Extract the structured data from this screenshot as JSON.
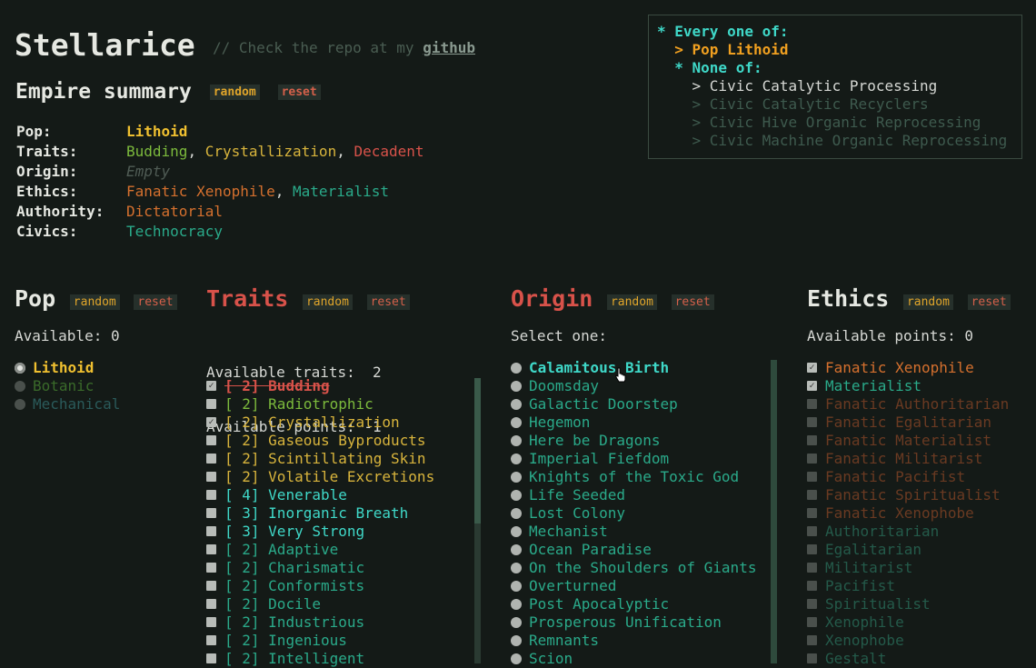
{
  "header": {
    "title": "Stellarice",
    "comment_prefix": "// Check the repo at my ",
    "github_link": "github"
  },
  "summary": {
    "heading": "Empire summary",
    "random_label": "random",
    "reset_label": "reset",
    "pop_key": "Pop:",
    "pop_value": "Lithoid",
    "traits_key": "Traits:",
    "traits": [
      "Budding",
      "Crystallization",
      "Decadent"
    ],
    "origin_key": "Origin:",
    "origin_value": "Empty",
    "ethics_key": "Ethics:",
    "ethics": [
      "Fanatic Xenophile",
      "Materialist"
    ],
    "authority_key": "Authority:",
    "authority_value": "Dictatorial",
    "civics_key": "Civics:",
    "civics_value": "Technocracy",
    "separator": ", "
  },
  "rules": {
    "line1": "* Every one of:",
    "line2": "  > Pop Lithoid",
    "line3": "  * None of:",
    "line4": "    > Civic Catalytic Processing",
    "line5": "    > Civic Catalytic Recyclers",
    "line6": "    > Civic Hive Organic Reprocessing",
    "line7": "    > Civic Machine Organic Reprocessing"
  },
  "pop": {
    "heading": "Pop",
    "random_label": "random",
    "reset_label": "reset",
    "available": "Available: 0",
    "items": [
      "Lithoid",
      "Botanic",
      "Mechanical"
    ]
  },
  "traits": {
    "heading": "Traits",
    "random_label": "random",
    "reset_label": "reset",
    "available_traits": "Available traits:  2",
    "available_points": "Available points: -1",
    "items": [
      {
        "cost": "[ 2]",
        "name": "Budding"
      },
      {
        "cost": "[ 2]",
        "name": "Radiotrophic"
      },
      {
        "cost": "[ 2]",
        "name": "Crystallization"
      },
      {
        "cost": "[ 2]",
        "name": "Gaseous Byproducts"
      },
      {
        "cost": "[ 2]",
        "name": "Scintillating Skin"
      },
      {
        "cost": "[ 2]",
        "name": "Volatile Excretions"
      },
      {
        "cost": "[ 4]",
        "name": "Venerable"
      },
      {
        "cost": "[ 3]",
        "name": "Inorganic Breath"
      },
      {
        "cost": "[ 3]",
        "name": "Very Strong"
      },
      {
        "cost": "[ 2]",
        "name": "Adaptive"
      },
      {
        "cost": "[ 2]",
        "name": "Charismatic"
      },
      {
        "cost": "[ 2]",
        "name": "Conformists"
      },
      {
        "cost": "[ 2]",
        "name": "Docile"
      },
      {
        "cost": "[ 2]",
        "name": "Industrious"
      },
      {
        "cost": "[ 2]",
        "name": "Ingenious"
      },
      {
        "cost": "[ 2]",
        "name": "Intelligent"
      }
    ]
  },
  "origin": {
    "heading": "Origin",
    "random_label": "random",
    "reset_label": "reset",
    "select": "Select one:",
    "items": [
      "Calamitous Birth",
      "Doomsday",
      "Galactic Doorstep",
      "Hegemon",
      "Here be Dragons",
      "Imperial Fiefdom",
      "Knights of the Toxic God",
      "Life Seeded",
      "Lost Colony",
      "Mechanist",
      "Ocean Paradise",
      "On the Shoulders of Giants",
      "Overturned",
      "Post Apocalyptic",
      "Prosperous Unification",
      "Remnants",
      "Scion"
    ]
  },
  "ethics": {
    "heading": "Ethics",
    "random_label": "random",
    "reset_label": "reset",
    "available": "Available points: 0",
    "items": [
      "Fanatic Xenophile",
      "Materialist",
      "Fanatic Authoritarian",
      "Fanatic Egalitarian",
      "Fanatic Materialist",
      "Fanatic Militarist",
      "Fanatic Pacifist",
      "Fanatic Spiritualist",
      "Fanatic Xenophobe",
      "Authoritarian",
      "Egalitarian",
      "Militarist",
      "Pacifist",
      "Spiritualist",
      "Xenophile",
      "Xenophobe",
      "Gestalt"
    ]
  },
  "colors": {
    "background": "#141a17",
    "pop_selected": "#f0c030",
    "trait_green": "#7cba3c",
    "trait_gold": "#d8b43c",
    "trait_red": "#d8524a",
    "trait_cyan": "#3fd8c8",
    "trait_teal": "#2aaa8a",
    "ethic_orange": "#d5702e",
    "ethic_teal": "#2aaa8a"
  }
}
